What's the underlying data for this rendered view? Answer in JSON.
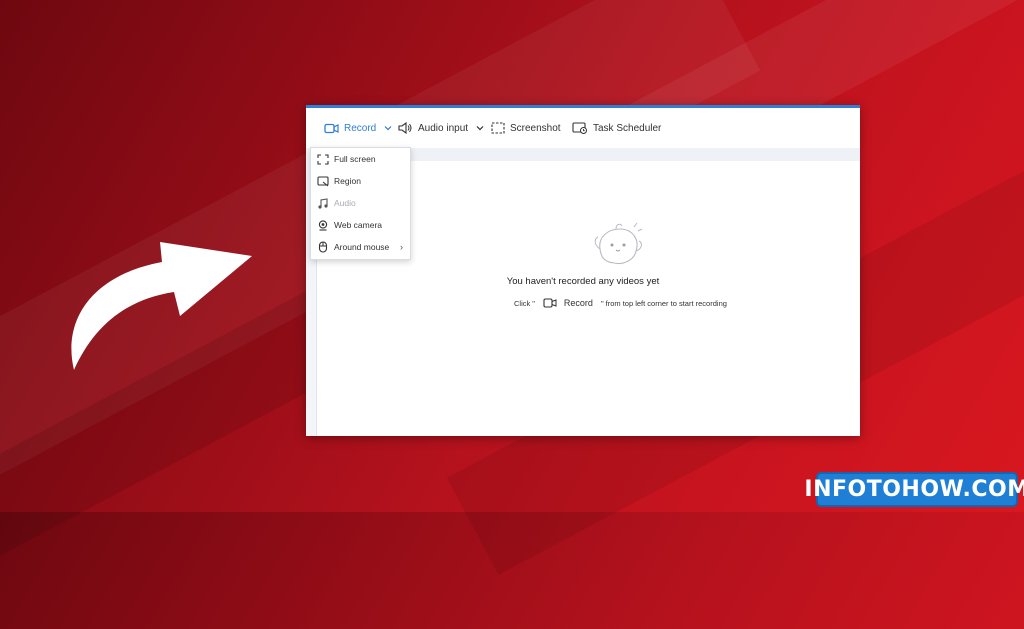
{
  "toolbar": {
    "record_label": "Record",
    "audio_input_label": "Audio input",
    "screenshot_label": "Screenshot",
    "task_scheduler_label": "Task Scheduler"
  },
  "record_menu": {
    "items": [
      {
        "label": "Full screen",
        "icon": "fullscreen-icon",
        "enabled": true
      },
      {
        "label": "Region",
        "icon": "region-icon",
        "enabled": true
      },
      {
        "label": "Audio",
        "icon": "music-note-icon",
        "enabled": false
      },
      {
        "label": "Web camera",
        "icon": "webcam-icon",
        "enabled": true
      },
      {
        "label": "Around mouse",
        "icon": "mouse-icon",
        "enabled": true,
        "has_submenu": true
      }
    ]
  },
  "empty_state": {
    "title": "You haven't recorded any videos yet",
    "hint_prefix": "Click",
    "hint_quote": "\"",
    "hint_button": "Record",
    "hint_suffix": "from top left corner to start recording"
  },
  "watermark": {
    "text": "INFOTOHOW.COM"
  },
  "colors": {
    "accent": "#2f7fd6",
    "background_red": "#c8141f",
    "watermark_blue": "#1f7fd4"
  }
}
